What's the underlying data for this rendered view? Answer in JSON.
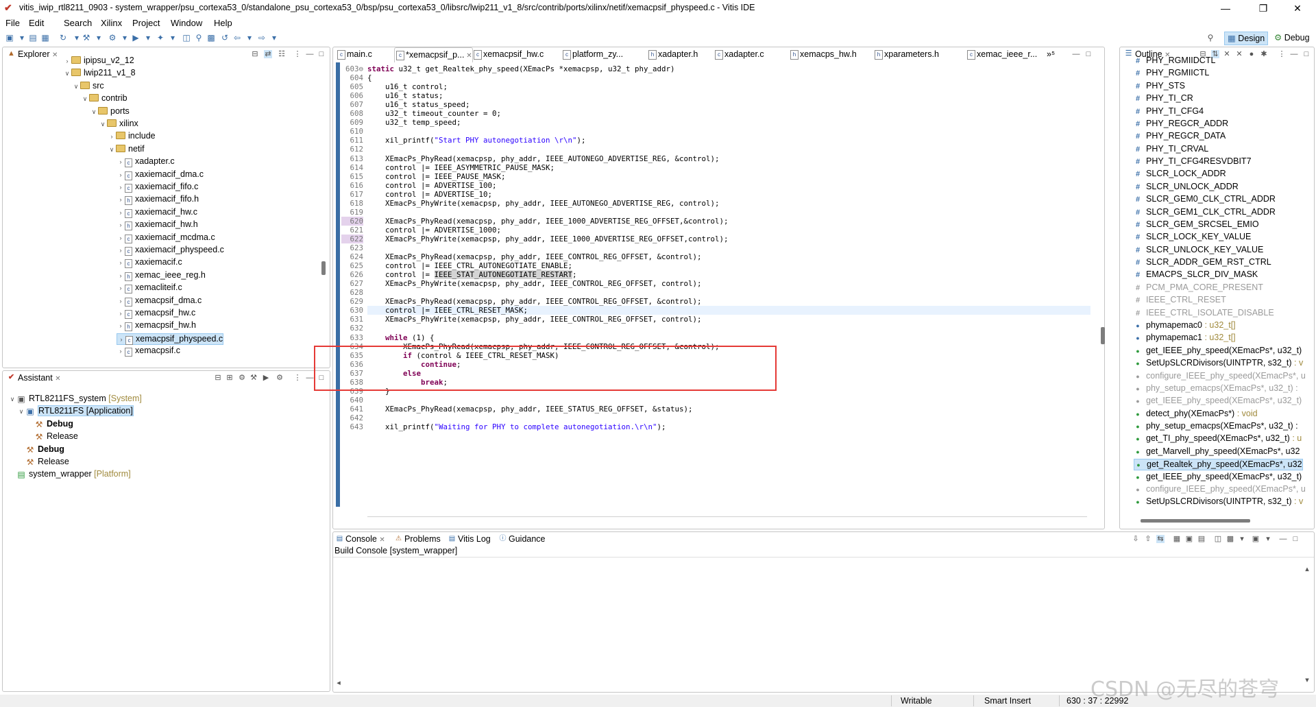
{
  "window": {
    "title": "vitis_iwip_rtl8211_0903 - system_wrapper/psu_cortexa53_0/standalone_psu_cortexa53_0/bsp/psu_cortexa53_0/libsrc/lwip211_v1_8/src/contrib/ports/xilinx/netif/xemacpsif_physpeed.c - Vitis IDE",
    "minimize": "—",
    "maximize": "❐",
    "close": "✕"
  },
  "menu": [
    "File",
    "Edit",
    "Search",
    "Xilinx",
    "Project",
    "Window",
    "Help"
  ],
  "perspectives": {
    "design": "Design",
    "debug": "Debug"
  },
  "explorer": {
    "title": "Explorer",
    "items": [
      {
        "label": "ipipsu_v2_12",
        "depth": 0,
        "type": "folder",
        "open": false
      },
      {
        "label": "lwip211_v1_8",
        "depth": 0,
        "type": "folder",
        "open": true
      },
      {
        "label": "src",
        "depth": 1,
        "type": "folder",
        "open": true
      },
      {
        "label": "contrib",
        "depth": 2,
        "type": "folder",
        "open": true
      },
      {
        "label": "ports",
        "depth": 3,
        "type": "folder",
        "open": true
      },
      {
        "label": "xilinx",
        "depth": 4,
        "type": "folder",
        "open": true
      },
      {
        "label": "include",
        "depth": 5,
        "type": "folder",
        "open": false
      },
      {
        "label": "netif",
        "depth": 5,
        "type": "folder",
        "open": true
      },
      {
        "label": "xadapter.c",
        "depth": 6,
        "type": "file"
      },
      {
        "label": "xaxiemacif_dma.c",
        "depth": 6,
        "type": "file"
      },
      {
        "label": "xaxiemacif_fifo.c",
        "depth": 6,
        "type": "file"
      },
      {
        "label": "xaxiemacif_fifo.h",
        "depth": 6,
        "type": "file"
      },
      {
        "label": "xaxiemacif_hw.c",
        "depth": 6,
        "type": "file"
      },
      {
        "label": "xaxiemacif_hw.h",
        "depth": 6,
        "type": "file"
      },
      {
        "label": "xaxiemacif_mcdma.c",
        "depth": 6,
        "type": "file"
      },
      {
        "label": "xaxiemacif_physpeed.c",
        "depth": 6,
        "type": "file"
      },
      {
        "label": "xaxiemacif.c",
        "depth": 6,
        "type": "file"
      },
      {
        "label": "xemac_ieee_reg.h",
        "depth": 6,
        "type": "file"
      },
      {
        "label": "xemacliteif.c",
        "depth": 6,
        "type": "file"
      },
      {
        "label": "xemacpsif_dma.c",
        "depth": 6,
        "type": "file"
      },
      {
        "label": "xemacpsif_hw.c",
        "depth": 6,
        "type": "file"
      },
      {
        "label": "xemacpsif_hw.h",
        "depth": 6,
        "type": "file"
      },
      {
        "label": "xemacpsif_physpeed.c",
        "depth": 6,
        "type": "file",
        "selected": true
      },
      {
        "label": "xemacpsif.c",
        "depth": 6,
        "type": "file"
      }
    ]
  },
  "assistant": {
    "title": "Assistant",
    "items": [
      {
        "label": "RTL8211FS_system",
        "deco": "[System]",
        "depth": 0
      },
      {
        "label": "RTL8211FS [Application]",
        "deco": "",
        "depth": 1,
        "selected": true
      },
      {
        "label": "Debug",
        "deco": "",
        "depth": 2,
        "bold": true
      },
      {
        "label": "Release",
        "deco": "",
        "depth": 2
      },
      {
        "label": "Debug",
        "deco": "",
        "depth": 1,
        "bold": true
      },
      {
        "label": "Release",
        "deco": "",
        "depth": 1
      },
      {
        "label": "system_wrapper",
        "deco": "[Platform]",
        "depth": 0
      }
    ]
  },
  "editor": {
    "tabs": [
      "main.c",
      "*xemacpsif_p...",
      "xemacpsif_hw.c",
      "platform_zy...",
      "xadapter.h",
      "xadapter.c",
      "xemacps_hw.h",
      "xparameters.h",
      "xemac_ieee_r..."
    ],
    "overflow": "»⁵",
    "lines": [
      {
        "n": "603⊖",
        "t": "static u32_t get_Realtek_phy_speed(XEmacPs *xemacpsp, u32_t phy_addr)"
      },
      {
        "n": "604",
        "t": "{"
      },
      {
        "n": "605",
        "t": "    u16_t control;"
      },
      {
        "n": "606",
        "t": "    u16_t status;"
      },
      {
        "n": "607",
        "t": "    u16_t status_speed;"
      },
      {
        "n": "608",
        "t": "    u32_t timeout_counter = 0;"
      },
      {
        "n": "609",
        "t": "    u32_t temp_speed;"
      },
      {
        "n": "610",
        "t": ""
      },
      {
        "n": "611",
        "t": "    xil_printf(\"Start PHY autonegotiation \\r\\n\");"
      },
      {
        "n": "612",
        "t": ""
      },
      {
        "n": "613",
        "t": "    XEmacPs_PhyRead(xemacpsp, phy_addr, IEEE_AUTONEGO_ADVERTISE_REG, &control);"
      },
      {
        "n": "614",
        "t": "    control |= IEEE_ASYMMETRIC_PAUSE_MASK;"
      },
      {
        "n": "615",
        "t": "    control |= IEEE_PAUSE_MASK;"
      },
      {
        "n": "616",
        "t": "    control |= ADVERTISE_100;"
      },
      {
        "n": "617",
        "t": "    control |= ADVERTISE_10;"
      },
      {
        "n": "618",
        "t": "    XEmacPs_PhyWrite(xemacpsp, phy_addr, IEEE_AUTONEGO_ADVERTISE_REG, control);"
      },
      {
        "n": "619",
        "t": ""
      },
      {
        "n": "620",
        "t": "    XEmacPs_PhyRead(xemacpsp, phy_addr, IEEE_1000_ADVERTISE_REG_OFFSET,&control);"
      },
      {
        "n": "621",
        "t": "    control |= ADVERTISE_1000;"
      },
      {
        "n": "622",
        "t": "    XEmacPs_PhyWrite(xemacpsp, phy_addr, IEEE_1000_ADVERTISE_REG_OFFSET,control);"
      },
      {
        "n": "623",
        "t": ""
      },
      {
        "n": "624",
        "t": "    XEmacPs_PhyRead(xemacpsp, phy_addr, IEEE_CONTROL_REG_OFFSET, &control);"
      },
      {
        "n": "625",
        "t": "    control |= IEEE_CTRL_AUTONEGOTIATE_ENABLE;"
      },
      {
        "n": "626",
        "t": "    control |= IEEE_STAT_AUTONEGOTIATE_RESTART;"
      },
      {
        "n": "627",
        "t": "    XEmacPs_PhyWrite(xemacpsp, phy_addr, IEEE_CONTROL_REG_OFFSET, control);"
      },
      {
        "n": "628",
        "t": ""
      },
      {
        "n": "629",
        "t": "    XEmacPs_PhyRead(xemacpsp, phy_addr, IEEE_CONTROL_REG_OFFSET, &control);"
      },
      {
        "n": "630",
        "t": "    control |= IEEE_CTRL_RESET_MASK;"
      },
      {
        "n": "631",
        "t": "    XEmacPs_PhyWrite(xemacpsp, phy_addr, IEEE_CONTROL_REG_OFFSET, control);"
      },
      {
        "n": "632",
        "t": ""
      },
      {
        "n": "633",
        "t": "    while (1) {"
      },
      {
        "n": "634",
        "t": "        XEmacPs_PhyRead(xemacpsp, phy_addr, IEEE_CONTROL_REG_OFFSET, &control);"
      },
      {
        "n": "635",
        "t": "        if (control & IEEE_CTRL_RESET_MASK)"
      },
      {
        "n": "636",
        "t": "            continue;"
      },
      {
        "n": "637",
        "t": "        else"
      },
      {
        "n": "638",
        "t": "            break;"
      },
      {
        "n": "639",
        "t": "    }"
      },
      {
        "n": "640",
        "t": ""
      },
      {
        "n": "641",
        "t": "    XEmacPs_PhyRead(xemacpsp, phy_addr, IEEE_STATUS_REG_OFFSET, &status);"
      },
      {
        "n": "642",
        "t": ""
      },
      {
        "n": "643",
        "t": "    xil_printf(\"Waiting for PHY to complete autonegotiation.\\r\\n\");"
      }
    ]
  },
  "outline": {
    "title": "Outline",
    "items": [
      {
        "icon": "#",
        "label": "PHY_RGMIIDCTL",
        "type": ""
      },
      {
        "icon": "#",
        "label": "PHY_RGMIICTL",
        "type": ""
      },
      {
        "icon": "#",
        "label": "PHY_STS",
        "type": ""
      },
      {
        "icon": "#",
        "label": "PHY_TI_CR",
        "type": ""
      },
      {
        "icon": "#",
        "label": "PHY_TI_CFG4",
        "type": ""
      },
      {
        "icon": "#",
        "label": "PHY_REGCR_ADDR",
        "type": ""
      },
      {
        "icon": "#",
        "label": "PHY_REGCR_DATA",
        "type": ""
      },
      {
        "icon": "#",
        "label": "PHY_TI_CRVAL",
        "type": ""
      },
      {
        "icon": "#",
        "label": "PHY_TI_CFG4RESVDBIT7",
        "type": ""
      },
      {
        "icon": "#",
        "label": "SLCR_LOCK_ADDR",
        "type": ""
      },
      {
        "icon": "#",
        "label": "SLCR_UNLOCK_ADDR",
        "type": ""
      },
      {
        "icon": "#",
        "label": "SLCR_GEM0_CLK_CTRL_ADDR",
        "type": ""
      },
      {
        "icon": "#",
        "label": "SLCR_GEM1_CLK_CTRL_ADDR",
        "type": ""
      },
      {
        "icon": "#",
        "label": "SLCR_GEM_SRCSEL_EMIO",
        "type": ""
      },
      {
        "icon": "#",
        "label": "SLCR_LOCK_KEY_VALUE",
        "type": ""
      },
      {
        "icon": "#",
        "label": "SLCR_UNLOCK_KEY_VALUE",
        "type": ""
      },
      {
        "icon": "#",
        "label": "SLCR_ADDR_GEM_RST_CTRL",
        "type": ""
      },
      {
        "icon": "#",
        "label": "EMACPS_SLCR_DIV_MASK",
        "type": ""
      },
      {
        "icon": "#",
        "label": "PCM_PMA_CORE_PRESENT",
        "type": "",
        "grey": true
      },
      {
        "icon": "#",
        "label": "IEEE_CTRL_RESET",
        "type": "",
        "grey": true
      },
      {
        "icon": "#",
        "label": "IEEE_CTRL_ISOLATE_DISABLE",
        "type": "",
        "grey": true
      },
      {
        "icon": "●",
        "label": "phymapemac0",
        "type": " : u32_t[]"
      },
      {
        "icon": "●",
        "label": "phymapemac1",
        "type": " : u32_t[]"
      },
      {
        "icon": "●",
        "label": "get_IEEE_phy_speed(XEmacPs*, u32_t)",
        "type": ""
      },
      {
        "icon": "●",
        "label": "SetUpSLCRDivisors(UINTPTR, s32_t)",
        "type": " : v"
      },
      {
        "icon": "●",
        "label": "configure_IEEE_phy_speed(XEmacPs*, u",
        "type": "",
        "grey": true
      },
      {
        "icon": "●",
        "label": "phy_setup_emacps(XEmacPs*, u32_t) :",
        "type": "",
        "grey": true
      },
      {
        "icon": "●",
        "label": "get_IEEE_phy_speed(XEmacPs*, u32_t)",
        "type": "",
        "grey": true
      },
      {
        "icon": "●",
        "label": "detect_phy(XEmacPs*)",
        "type": " : void"
      },
      {
        "icon": "●",
        "label": "phy_setup_emacps(XEmacPs*, u32_t) :",
        "type": ""
      },
      {
        "icon": "●",
        "label": "get_TI_phy_speed(XEmacPs*, u32_t)",
        "type": " : u"
      },
      {
        "icon": "●",
        "label": "get_Marvell_phy_speed(XEmacPs*, u32",
        "type": ""
      },
      {
        "icon": "●",
        "label": "get_Realtek_phy_speed(XEmacPs*, u32",
        "type": "",
        "selected": true
      },
      {
        "icon": "●",
        "label": "get_IEEE_phy_speed(XEmacPs*, u32_t)",
        "type": ""
      },
      {
        "icon": "●",
        "label": "configure_IEEE_phy_speed(XEmacPs*, u",
        "type": "",
        "grey": true
      },
      {
        "icon": "●",
        "label": "SetUpSLCRDivisors(UINTPTR, s32_t)",
        "type": " : v"
      }
    ]
  },
  "console": {
    "tabs": [
      "Console",
      "Problems",
      "Vitis Log",
      "Guidance"
    ],
    "subtitle": "Build Console [system_wrapper]"
  },
  "status": {
    "writable": "Writable",
    "insert": "Smart Insert",
    "position": "630 : 37 : 22992"
  },
  "watermark": "CSDN @无尽的苍穹",
  "colors": {
    "highlight_box": "#e53935",
    "selection": "#cce4f7"
  }
}
